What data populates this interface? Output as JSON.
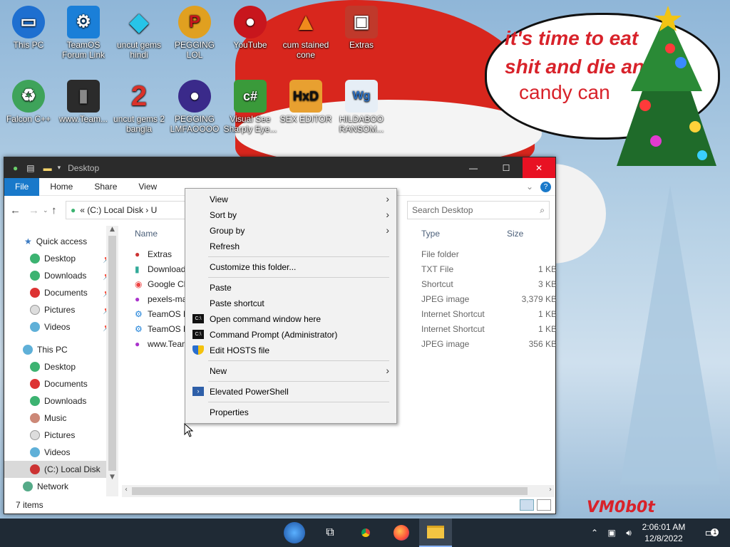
{
  "desktop": {
    "speech_bubble": "it's time to eat shit and die and",
    "speech_bubble_2": "candy can",
    "watermark": "VM0b0t",
    "icons_row1": [
      {
        "label": "This PC",
        "icon": "computer-icon",
        "color": "#1e6fd0"
      },
      {
        "label": "TeamOS Forum Link",
        "icon": "gear-icon",
        "color": "#1a7fd8"
      },
      {
        "label": "uncut gems hindi",
        "icon": "gem-icon",
        "color": "#27c4e8"
      },
      {
        "label": "PEGGING LOL",
        "icon": "p-logo-icon",
        "color": "#e0a020"
      },
      {
        "label": "YouTube",
        "icon": "angry-bird-icon",
        "color": "#c8161d"
      },
      {
        "label": "cum stained cone",
        "icon": "traffic-cone-icon",
        "color": "#f08a1c"
      },
      {
        "label": "Extras",
        "icon": "extras-box-icon",
        "color": "#c0392b"
      }
    ],
    "icons_row2": [
      {
        "label": "Falcon C++",
        "icon": "falcon-icon",
        "color": "#3ea35a"
      },
      {
        "label": "www.Team...",
        "icon": "dark-file-icon",
        "color": "#2b2b2b"
      },
      {
        "label": "uncut gems 2 bangla",
        "icon": "number-two-icon",
        "color": "#d9322a"
      },
      {
        "label": "PEGGING LMFAOOOO",
        "icon": "orb-icon",
        "color": "#3a2a8a"
      },
      {
        "label": "Visual See Sharply Eye...",
        "icon": "csharp-icon",
        "color": "#3a9a3a"
      },
      {
        "label": "SEX EDITOR",
        "icon": "hxd-icon",
        "color": "#e8a030"
      },
      {
        "label": "HILDABOO RANSOM...",
        "icon": "scroll-wg-icon",
        "color": "#2a6fc4"
      }
    ]
  },
  "window": {
    "title": "Desktop",
    "ribbon_tabs": [
      "File",
      "Home",
      "Share",
      "View"
    ],
    "address": "« (C:) Local Disk › U",
    "search_placeholder": "Search Desktop",
    "nav": {
      "quick_access": "Quick access",
      "quick_items": [
        "Desktop",
        "Downloads",
        "Documents",
        "Pictures",
        "Videos"
      ],
      "this_pc": "This PC",
      "pc_items": [
        "Desktop",
        "Documents",
        "Downloads",
        "Music",
        "Pictures",
        "Videos",
        "(C:) Local Disk"
      ],
      "network": "Network"
    },
    "columns": {
      "name": "Name",
      "type": "Type",
      "size": "Size"
    },
    "files": [
      {
        "name": "Extras",
        "type": "File folder",
        "size": ""
      },
      {
        "name": "Download",
        "type": "TXT File",
        "size": "1 KB"
      },
      {
        "name": "Google Ch",
        "type": "Shortcut",
        "size": "3 KB"
      },
      {
        "name": "pexels-ma",
        "type": "JPEG image",
        "size": "3,379 KB"
      },
      {
        "name": "TeamOS F",
        "type": "Internet Shortcut",
        "size": "1 KB"
      },
      {
        "name": "TeamOS F",
        "type": "Internet Shortcut",
        "size": "1 KB"
      },
      {
        "name": "www.Team",
        "type": "JPEG image",
        "size": "356 KB"
      }
    ],
    "status": "7 items"
  },
  "context_menu": {
    "view": "View",
    "sort_by": "Sort by",
    "group_by": "Group by",
    "refresh": "Refresh",
    "customize": "Customize this folder...",
    "paste": "Paste",
    "paste_shortcut": "Paste shortcut",
    "open_cmd": "Open command window here",
    "cmd_admin": "Command Prompt (Administrator)",
    "edit_hosts": "Edit HOSTS file",
    "new": "New",
    "powershell": "Elevated PowerShell",
    "properties": "Properties"
  },
  "taskbar": {
    "time": "2:06:01 AM",
    "date": "12/8/2022",
    "notifications": "1"
  }
}
